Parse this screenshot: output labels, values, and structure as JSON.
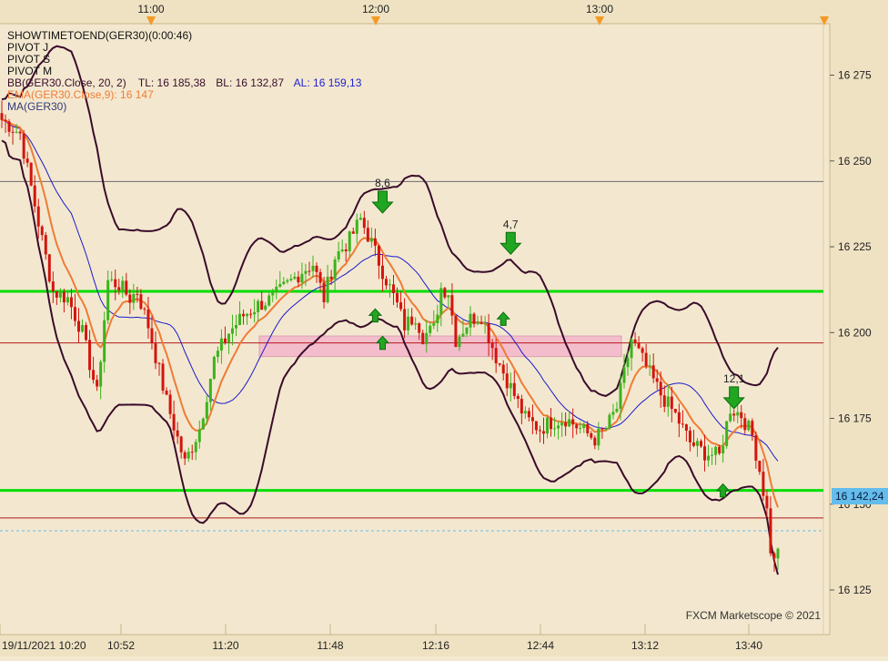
{
  "header": {
    "times": [
      "11:00",
      "12:00",
      "13:00"
    ]
  },
  "legend": {
    "line1": "SHOWTIMETOEND(GER30)(0:00:46)",
    "line2": "PIVOT J",
    "line3": "PIVOT S",
    "line4": "PIVOT M",
    "bb_label": "BB(GER30.Close, 20, 2)",
    "bb_tl": "TL: 16 185,38",
    "bb_bl": "BL: 16 132,87",
    "bb_al": "AL: 16 159,13",
    "ema_label": "EMA(GER30.Close,9): 16 147",
    "ma_label": "MA(GER30)"
  },
  "price_tag": "16 142,24",
  "watermark": "FXCM Marketscope © 2021",
  "annotations": [
    "8,6",
    "4,7",
    "12,1"
  ],
  "colors": {
    "background": "#f3e8cf",
    "bull": "#3cb31c",
    "bear": "#d3150e",
    "ema": "#f07b36",
    "ma": "#1a1acb",
    "bands": "#3a0b2b",
    "pivot_green": "#00dd00",
    "pivot_red": "#b21a1a",
    "zone": "#f4b9cc",
    "price_tag": "#63bcec"
  },
  "chart_data": {
    "type": "candlestick",
    "symbol": "GER30",
    "x_ticks": [
      "19/11/2021 10:20",
      "10:52",
      "11:20",
      "11:48",
      "12:16",
      "12:44",
      "13:12",
      "13:40"
    ],
    "y_ticks": [
      16125,
      16150,
      16175,
      16200,
      16225,
      16250,
      16275
    ],
    "ylim": [
      16112,
      16290
    ],
    "horizontal_lines": [
      {
        "name": "pivot-green-upper",
        "value": 16212,
        "color": "green"
      },
      {
        "name": "pivot-green-lower",
        "value": 16154,
        "color": "green"
      },
      {
        "name": "pivot-red-upper",
        "value": 16197,
        "color": "red"
      },
      {
        "name": "pivot-red-lower",
        "value": 16146,
        "color": "red"
      },
      {
        "name": "pivot-gray",
        "value": 16244,
        "color": "gray"
      },
      {
        "name": "current-price",
        "value": 16142.24,
        "color": "cyan-dashed"
      }
    ],
    "close_anchors": [
      [
        0,
        16262
      ],
      [
        5,
        16258
      ],
      [
        10,
        16232
      ],
      [
        14,
        16212
      ],
      [
        18,
        16210
      ],
      [
        22,
        16200
      ],
      [
        26,
        16182
      ],
      [
        29,
        16215
      ],
      [
        32,
        16214
      ],
      [
        35,
        16210
      ],
      [
        37,
        16212
      ],
      [
        40,
        16202
      ],
      [
        45,
        16180
      ],
      [
        50,
        16162
      ],
      [
        54,
        16172
      ],
      [
        58,
        16192
      ],
      [
        62,
        16200
      ],
      [
        66,
        16205
      ],
      [
        70,
        16208
      ],
      [
        74,
        16210
      ],
      [
        78,
        16214
      ],
      [
        82,
        16218
      ],
      [
        85,
        16220
      ],
      [
        88,
        16210
      ],
      [
        91,
        16222
      ],
      [
        95,
        16227
      ],
      [
        98,
        16233
      ],
      [
        101,
        16226
      ],
      [
        104,
        16218
      ],
      [
        108,
        16208
      ],
      [
        110,
        16202
      ],
      [
        113,
        16205
      ],
      [
        115,
        16199
      ],
      [
        118,
        16201
      ],
      [
        120,
        16213
      ],
      [
        122,
        16212
      ],
      [
        124,
        16198
      ],
      [
        128,
        16204
      ],
      [
        131,
        16205
      ],
      [
        135,
        16193
      ],
      [
        139,
        16184
      ],
      [
        143,
        16175
      ],
      [
        147,
        16172
      ],
      [
        150,
        16174
      ],
      [
        154,
        16175
      ],
      [
        158,
        16172
      ],
      [
        162,
        16169
      ],
      [
        165,
        16172
      ],
      [
        168,
        16178
      ],
      [
        172,
        16198
      ],
      [
        176,
        16190
      ],
      [
        180,
        16182
      ],
      [
        184,
        16176
      ],
      [
        188,
        16168
      ],
      [
        192,
        16165
      ],
      [
        196,
        16164
      ],
      [
        199,
        16178
      ],
      [
        202,
        16176
      ],
      [
        205,
        16170
      ],
      [
        207,
        16160
      ],
      [
        209,
        16148
      ],
      [
        210,
        16137
      ],
      [
        211,
        16133
      ],
      [
        212,
        16138
      ]
    ],
    "candle_count": 213,
    "arrows": [
      {
        "type": "sell",
        "label": "8,6",
        "index": 104,
        "price": 16238
      },
      {
        "type": "buy",
        "label": "",
        "index": 104,
        "price": 16197
      },
      {
        "type": "buy",
        "label": "",
        "index": 102,
        "price": 16205
      },
      {
        "type": "sell",
        "label": "4,7",
        "index": 139,
        "price": 16226
      },
      {
        "type": "buy",
        "label": "",
        "index": 137,
        "price": 16204
      },
      {
        "type": "sell",
        "label": "12,1",
        "index": 200,
        "price": 16181
      },
      {
        "type": "buy",
        "label": "",
        "index": 197,
        "price": 16154
      }
    ],
    "zone": {
      "from_index": 76,
      "to_index": 196,
      "low": 16193,
      "high": 16199
    }
  }
}
